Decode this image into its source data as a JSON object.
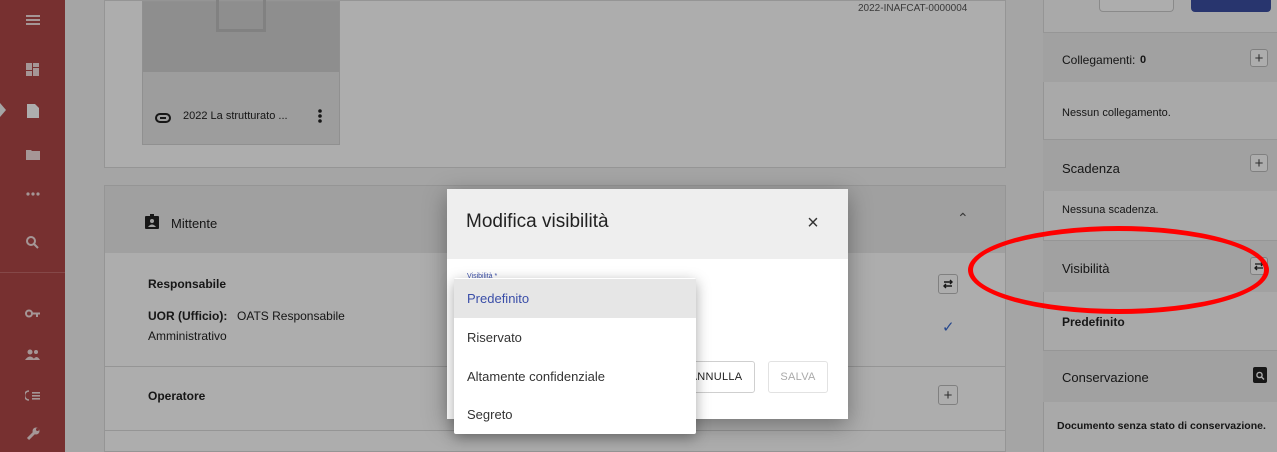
{
  "doc_card": {
    "attachment_name": "2022 La strutturato ...",
    "doc_code": "2022-INAFCAT-0000004"
  },
  "mittente": {
    "title": "Mittente",
    "responsabile_label": "Responsabile",
    "uor_label": "UOR (Ufficio):",
    "uor_value_line1": "OATS Responsabile",
    "uor_value_line2": "Amministrativo",
    "operatore_label": "Operatore"
  },
  "right_panel": {
    "collegamenti_label": "Collegamenti:",
    "collegamenti_count": "0",
    "collegamenti_empty": "Nessun collegamento.",
    "scadenza_label": "Scadenza",
    "scadenza_empty": "Nessuna scadenza.",
    "visibilita_label": "Visibilità",
    "visibilita_value": "Predefinito",
    "conservazione_label": "Conservazione",
    "conservazione_value": "Documento senza stato di conservazione."
  },
  "modal": {
    "title": "Modifica visibilità",
    "field_label": "Visibilità *",
    "cancel_label": "ANNULLA",
    "save_label": "SALVA"
  },
  "dropdown": {
    "options": [
      "Predefinito",
      "Riservato",
      "Altamente confidenziale",
      "Segreto"
    ],
    "selected": "Predefinito"
  },
  "annotation_color": "#ff0000",
  "rail_color": "#b04848"
}
